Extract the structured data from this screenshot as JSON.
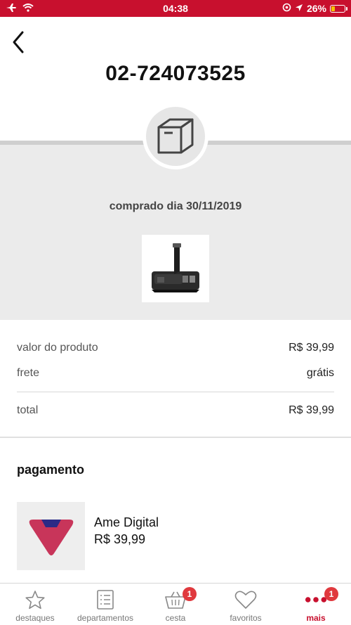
{
  "status_bar": {
    "time": "04:38",
    "battery": "26%",
    "battery_level": 0.26
  },
  "header": {
    "order_number": "02-724073525"
  },
  "order": {
    "purchase_date": "comprado dia 30/11/2019",
    "box_icon": "package-box-icon",
    "product_image": "hair-trimmer-kit"
  },
  "summary": {
    "product_value_label": "valor do produto",
    "product_value": "R$ 39,99",
    "shipping_label": "frete",
    "shipping_value": "grátis",
    "total_label": "total",
    "total_value": "R$ 39,99"
  },
  "payment": {
    "heading": "pagamento",
    "method": "Ame Digital",
    "amount": "R$ 39,99",
    "logo": "ame-digital-logo"
  },
  "nav": {
    "items": [
      {
        "label": "destaques",
        "icon": "star-icon"
      },
      {
        "label": "departamentos",
        "icon": "list-icon"
      },
      {
        "label": "cesta",
        "icon": "basket-icon",
        "badge": "1"
      },
      {
        "label": "favoritos",
        "icon": "heart-icon"
      },
      {
        "label": "mais",
        "icon": "more-dots-icon",
        "badge": "1",
        "active": true
      }
    ]
  },
  "colors": {
    "brand": "#c8102e",
    "badge": "#e0393e"
  }
}
